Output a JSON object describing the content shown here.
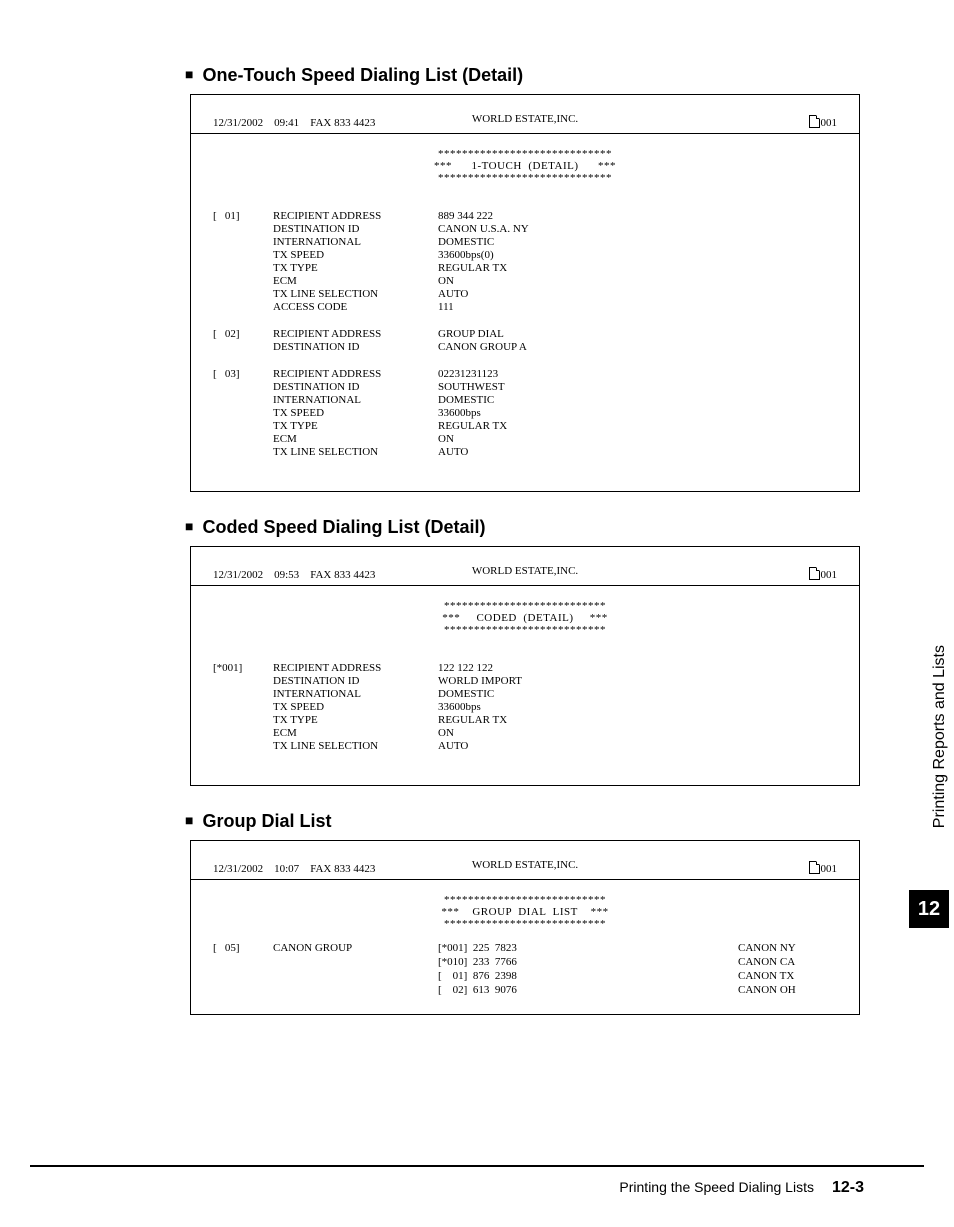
{
  "side_tab": "Printing Reports and Lists",
  "chapter_badge": "12",
  "footer": {
    "title": "Printing the Speed Dialing Lists",
    "page": "12-3"
  },
  "sections": {
    "one_touch": {
      "heading": "One-Touch Speed Dialing List (Detail)",
      "header": {
        "date": "12/31/2002",
        "time": "09:41",
        "fax": "FAX 833 4423",
        "company": "WORLD  ESTATE,INC.",
        "pagecount": "001"
      },
      "banner": {
        "stars": "*****************************",
        "side": "***",
        "title": "1-TOUCH  (DETAIL)"
      },
      "entries": [
        {
          "idx": "[   01]",
          "rows": [
            [
              "RECIPIENT ADDRESS",
              "889  344  222"
            ],
            [
              "DESTINATION  ID",
              "CANON U.S.A.  NY"
            ],
            [
              "INTERNATIONAL",
              "DOMESTIC"
            ],
            [
              "TX  SPEED",
              "33600bps(0)"
            ],
            [
              "TX  TYPE",
              "REGULAR  TX"
            ],
            [
              "ECM",
              "ON"
            ],
            [
              "TX LINE SELECTION",
              "AUTO"
            ],
            [
              "ACCESS CODE",
              "111"
            ]
          ]
        },
        {
          "idx": "[   02]",
          "rows": [
            [
              "RECIPIENT ADDRESS",
              "GROUP DIAL"
            ],
            [
              "DESTINATION  ID",
              "CANON GROUP A"
            ]
          ]
        },
        {
          "idx": "[   03]",
          "rows": [
            [
              "RECIPIENT ADDRESS",
              "02231231123"
            ],
            [
              "DESTINATION  ID",
              "SOUTHWEST"
            ],
            [
              "INTERNATIONAL",
              "DOMESTIC"
            ],
            [
              "TX  SPEED",
              "33600bps"
            ],
            [
              "TX  TYPE",
              "REGULAR  TX"
            ],
            [
              "ECM",
              "ON"
            ],
            [
              "TX LINE SELECTION",
              "AUTO"
            ]
          ]
        }
      ]
    },
    "coded": {
      "heading": "Coded Speed Dialing List (Detail)",
      "header": {
        "date": "12/31/2002",
        "time": "09:53",
        "fax": "FAX 833 4423",
        "company": "WORLD  ESTATE,INC.",
        "pagecount": "001"
      },
      "banner": {
        "stars": "***************************",
        "side": "***",
        "title": "CODED  (DETAIL)"
      },
      "entries": [
        {
          "idx": "[*001]",
          "rows": [
            [
              "RECIPIENT ADDRESS",
              "122  122  122"
            ],
            [
              "DESTINATION  ID",
              "WORLD IMPORT"
            ],
            [
              "INTERNATIONAL",
              "DOMESTIC"
            ],
            [
              "TX  SPEED",
              "33600bps"
            ],
            [
              "TX  TYPE",
              "REGULAR  TX"
            ],
            [
              "ECM",
              "ON"
            ],
            [
              "TX LINE SELECTION",
              "AUTO"
            ]
          ]
        }
      ]
    },
    "group": {
      "heading": "Group Dial List",
      "header": {
        "date": "12/31/2002",
        "time": "10:07",
        "fax": "FAX 833 4423",
        "company": "WORLD  ESTATE,INC.",
        "pagecount": "001"
      },
      "banner": {
        "stars": "***************************",
        "side": "***",
        "title": "GROUP  DIAL  LIST"
      },
      "group_idx": "[   05]",
      "group_name": "CANON  GROUP",
      "members": [
        {
          "code": "[*001]  225  7823",
          "name": "CANON  NY"
        },
        {
          "code": "[*010]  233  7766",
          "name": "CANON  CA"
        },
        {
          "code": "[    01]  876  2398",
          "name": "CANON  TX"
        },
        {
          "code": "[    02]  613  9076",
          "name": "CANON  OH"
        }
      ]
    }
  }
}
